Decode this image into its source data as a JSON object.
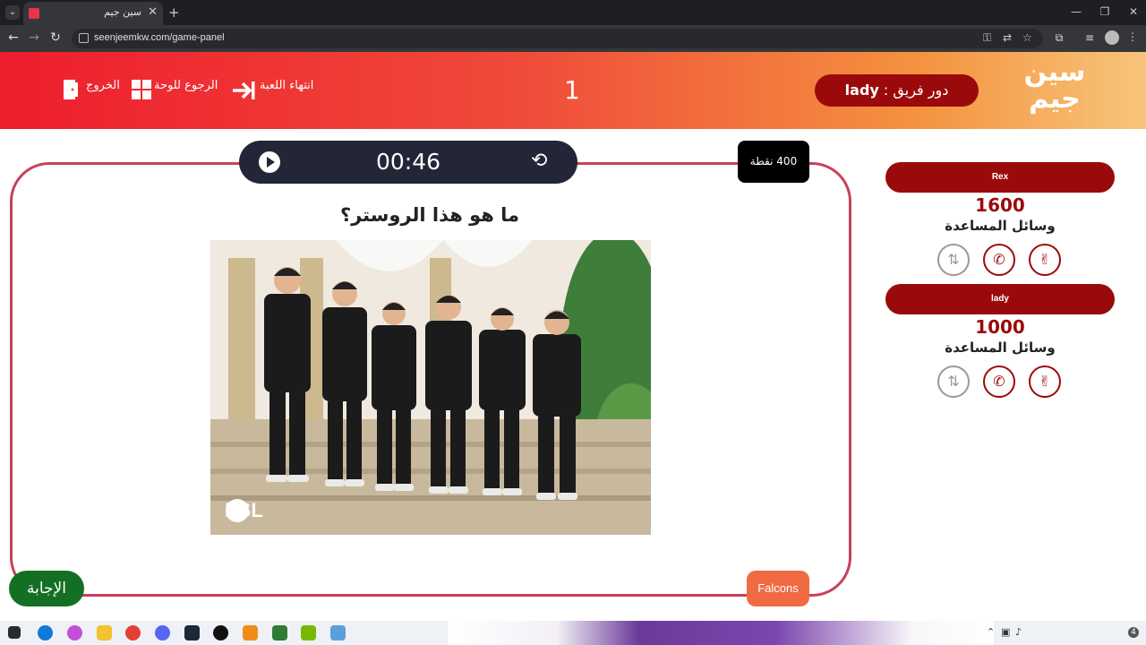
{
  "browser": {
    "tab_title": "سين جيم",
    "tab_close": "✕",
    "new_tab": "+",
    "menu_glyph": "⌄",
    "url": "seenjeemkw.com/game-panel",
    "window_controls": [
      "—",
      "❐",
      "✕"
    ],
    "nav_icons": [
      "arrow-left-icon",
      "arrow-right-icon",
      "reload-icon"
    ]
  },
  "header": {
    "logo_line1": "سين",
    "logo_line2": "جيم",
    "exit_label": "الخروج",
    "back_to_board_label": "الرجوع للوحة",
    "end_game_label": "انتهاء اللعبة",
    "round_number": "1",
    "turn_prefix": "دور فريق :",
    "turn_team": "lady"
  },
  "question_card": {
    "timer": "00:46",
    "points_label": "400 نقطة",
    "question_text": "ما هو هذا الروستر؟",
    "image_watermark": "ESL",
    "category_label": "Falcons",
    "answer_button": "الإجابة"
  },
  "teams": [
    {
      "name": "Rex",
      "score": "1600",
      "aids_label": "وسائل المساعدة"
    },
    {
      "name": "lady",
      "score": "1000",
      "aids_label": "وسائل المساعدة"
    }
  ],
  "aid_icons": [
    "two-answers-icon",
    "phone-icon",
    "swap-icon"
  ],
  "colors": {
    "header_start": "#ee1d2e",
    "header_end": "#f7c57a",
    "accent_dark_red": "#9b0a0a",
    "card_border": "#c8405a",
    "timer_bg": "#222636",
    "answer_green": "#137023",
    "category_orange": "#f06a43"
  },
  "taskbar": {
    "tray_badge": "4"
  }
}
